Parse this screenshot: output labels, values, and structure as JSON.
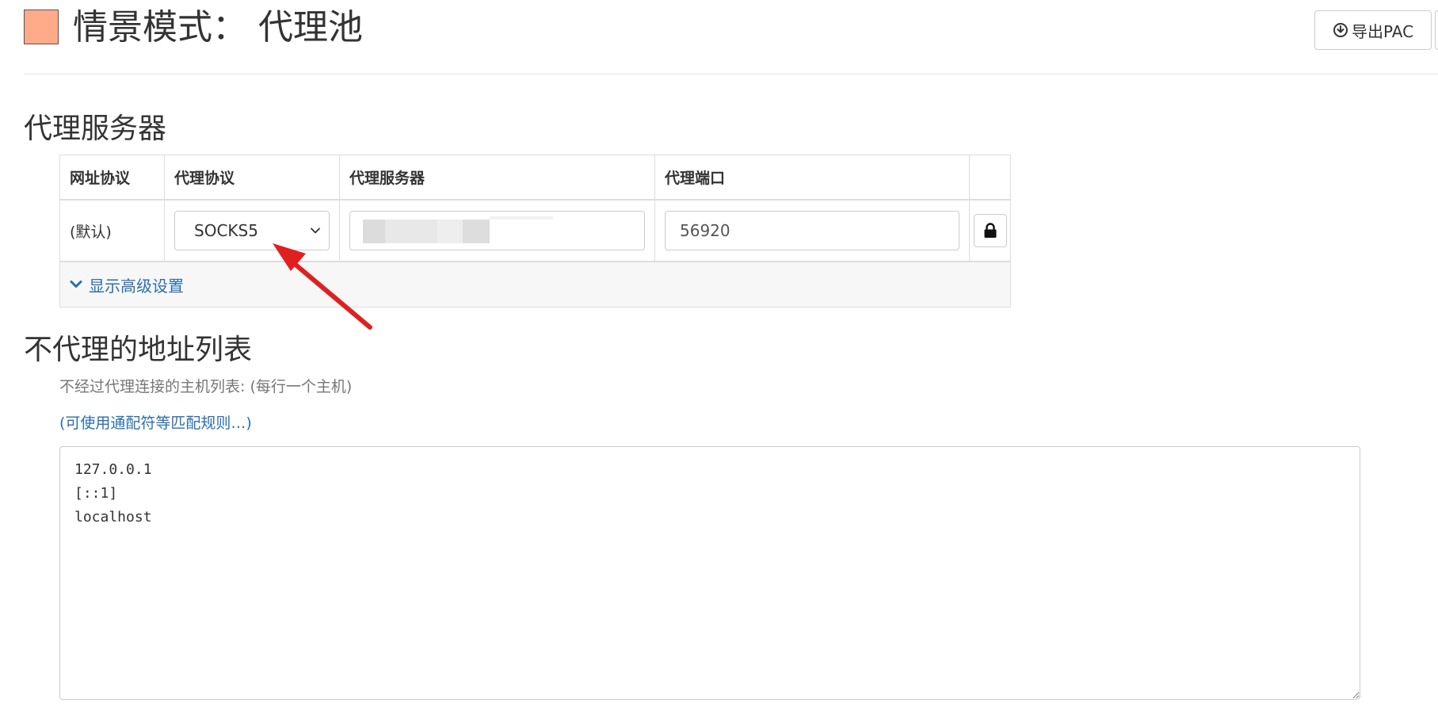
{
  "header": {
    "swatch_color": "#ffaa88",
    "title": "情景模式： 代理池",
    "export_button_label": "导出PAC",
    "export_icon": "download-circle-icon"
  },
  "proxy_section": {
    "title": "代理服务器",
    "table": {
      "headers": [
        "网址协议",
        "代理协议",
        "代理服务器",
        "代理端口"
      ],
      "row": {
        "url_scheme": "(默认)",
        "protocol": "SOCKS5",
        "server": "",
        "port": "56920",
        "auth_icon": "lock-icon"
      }
    },
    "advanced_link_label": "显示高级设置",
    "advanced_icon": "chevron-down-icon"
  },
  "bypass_section": {
    "title": "不代理的地址列表",
    "help_text": "不经过代理连接的主机列表: (每行一个主机)",
    "rules_link_label": "(可使用通配符等匹配规则…)",
    "list": "127.0.0.1\n[::1]\nlocalhost"
  },
  "colors": {
    "link": "#2a6fb0",
    "annotation_arrow": "#e02020"
  }
}
